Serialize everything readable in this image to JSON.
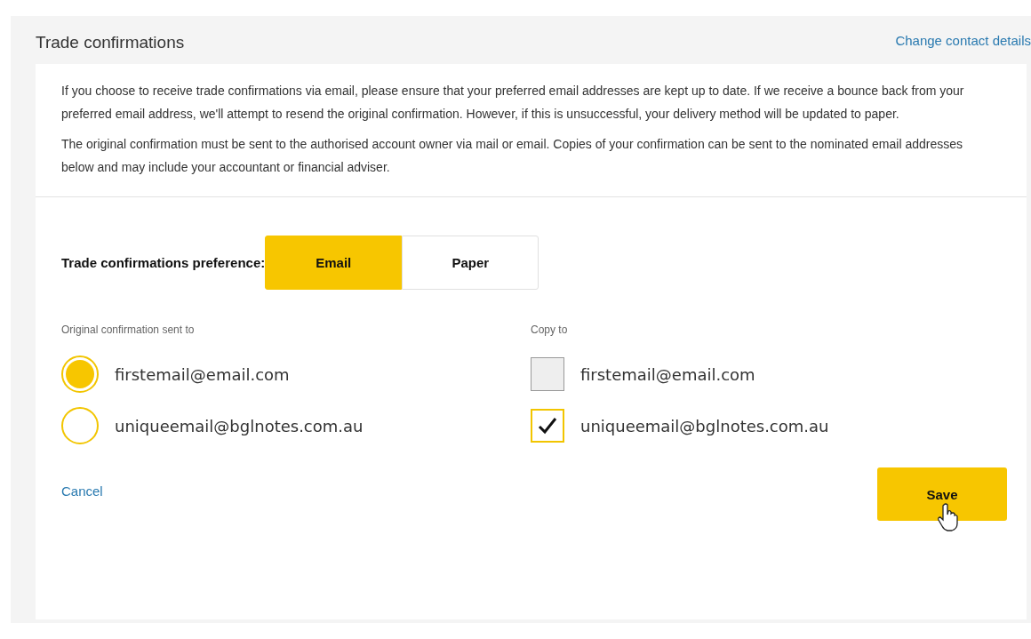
{
  "section": {
    "title": "Trade confirmations",
    "link": "Change contact details"
  },
  "info": [
    "If you choose to receive trade confirmations via email, please ensure that your preferred email addresses are kept up to date. If we receive a bounce back from your preferred email address, we'll attempt to resend the original confirmation. However, if this is unsuccessful, your delivery method will be updated to paper.",
    "The original confirmation must be sent to the authorised account owner via mail or email. Copies of your confirmation can be sent to the nominated email addresses below and may include your accountant or financial adviser."
  ],
  "preference": {
    "label": "Trade confirmations preference:",
    "options": [
      {
        "label": "Email",
        "selected": true
      },
      {
        "label": "Paper",
        "selected": false
      }
    ]
  },
  "original": {
    "label": "Original confirmation sent to",
    "options": [
      {
        "email": "firstemail@email.com",
        "selected": true
      },
      {
        "email": "uniqueemail@bglnotes.com.au",
        "selected": false
      }
    ]
  },
  "copy": {
    "label": "Copy to",
    "options": [
      {
        "email": "firstemail@email.com",
        "checked": false
      },
      {
        "email": "uniqueemail@bglnotes.com.au",
        "checked": true
      }
    ]
  },
  "actions": {
    "cancel": "Cancel",
    "save": "Save"
  }
}
